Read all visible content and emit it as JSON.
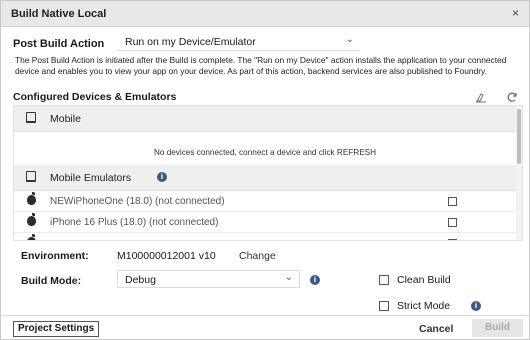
{
  "dialog": {
    "title": "Build Native Local",
    "close_glyph": "×"
  },
  "post_build": {
    "label": "Post Build Action",
    "selected": "Run on my Device/Emulator",
    "description": "The Post Build Action is initiated after the Build is complete. The \"Run on my Device\" action installs the application to your connected device and enables you to view your app on your device. As part of this action, backend services are also published to Foundry."
  },
  "devices": {
    "section_title": "Configured Devices & Emulators",
    "groups": [
      {
        "label": "Mobile",
        "empty_text": "No devices connected, connect a device and click REFRESH"
      },
      {
        "label": "Mobile Emulators"
      }
    ],
    "emulators": [
      {
        "label": "NEWiPhoneOne (18.0) (not connected)",
        "checked": false
      },
      {
        "label": "iPhone 16 Plus (18.0) (not connected)",
        "checked": false
      }
    ]
  },
  "environment": {
    "label": "Environment:",
    "value": "M100000012001 v10",
    "change_link": "Change"
  },
  "build_mode": {
    "label": "Build Mode:",
    "selected": "Debug"
  },
  "options": {
    "clean_build": "Clean Build",
    "strict_mode": "Strict Mode"
  },
  "footer": {
    "project_settings": "Project Settings",
    "cancel": "Cancel",
    "build": "Build"
  },
  "colors": {
    "info_icon": "#3d5a80",
    "titlebar": "#e8e8e8",
    "group_header": "#efefef",
    "disabled_button": "#e6e6e6"
  }
}
